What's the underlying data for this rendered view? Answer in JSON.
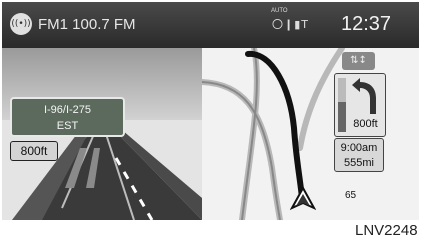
{
  "status_bar": {
    "station": "FM1 100.7 FM",
    "auto_label": "AUTO",
    "indicators": "〇❙▮T",
    "time": "12:37",
    "radio_icon": "radio-broadcast-icon"
  },
  "guidance": {
    "sign_road": "I-96/I-275",
    "sign_direction": "EST",
    "distance": "800ft"
  },
  "turn": {
    "distance": "800ft",
    "progress_fraction": 0.55,
    "arrow_icon": "turn-left-arrow-icon",
    "route_icon": "route-view-icon",
    "route_symbol": "⇅↕"
  },
  "trip": {
    "eta": "9:00am",
    "remaining": "555mi"
  },
  "map": {
    "speed_label": "65",
    "vehicle_icon": "vehicle-position-icon"
  },
  "caption": "LNV2248",
  "colors": {
    "route": "#111111",
    "sign_bg": "#5c6a5e",
    "map_bg": "#f2f2f2"
  }
}
